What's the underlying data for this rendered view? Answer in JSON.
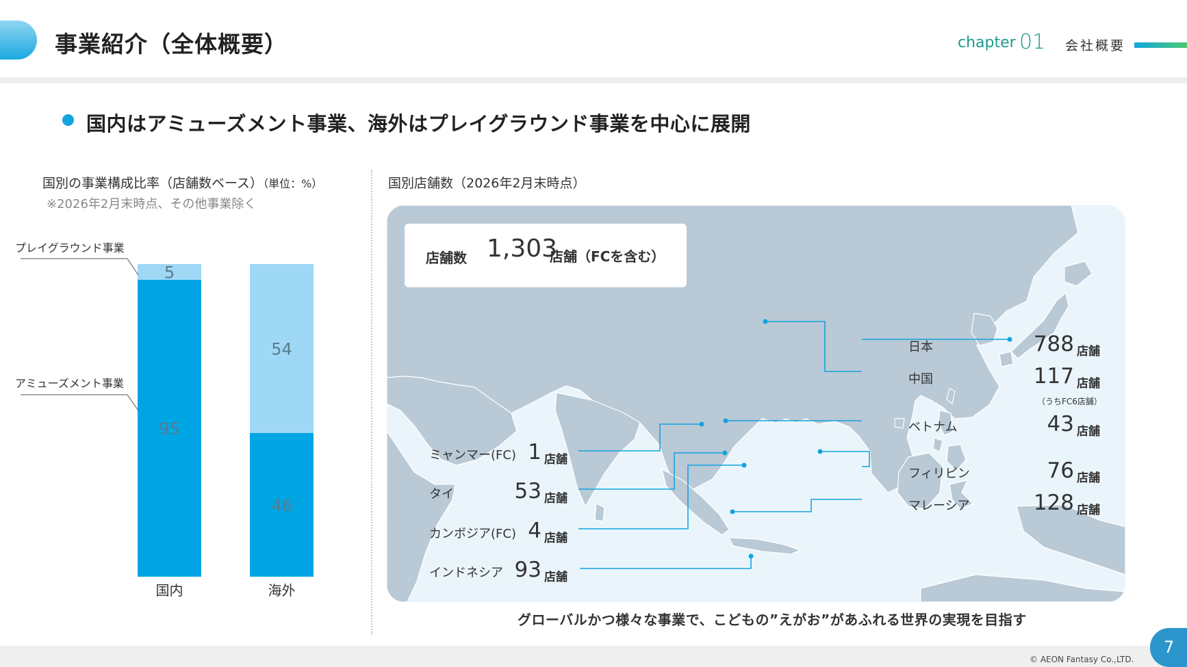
{
  "header": {
    "title": "事業紹介（全体概要）",
    "chapter_label": "chapter",
    "chapter_number": "01",
    "section": "会社概要"
  },
  "headline": "国内はアミューズメント事業、海外はプレイグラウンド事業を中心に展開",
  "left_chart": {
    "title": "国別の事業構成比率（店舗数ベース）",
    "unit": "（単位：%）",
    "note": "※2026年2月末時点、その他事業除く"
  },
  "map": {
    "title": "国別店舗数（2026年2月末時点）",
    "total_label": "店舗数",
    "total_value": "1,303",
    "total_suffix": "店舗（FCを含む）",
    "store_unit": "店舗"
  },
  "caption": "グローバルかつ様々な事業で、こどもの”えがお”があふれる世界の実現を目指す",
  "footer": {
    "copyright": "© AEON Fantasy Co.,LTD.",
    "page": "7"
  },
  "colors": {
    "amusement": "#00a6e4",
    "playground": "#9fd8f5",
    "accent": "#13a3df",
    "map_land": "#b9c9d6",
    "map_sea": "#eaf5fb"
  },
  "chart_data": [
    {
      "type": "bar",
      "stacked": true,
      "categories": [
        "国内",
        "海外"
      ],
      "series": [
        {
          "name": "アミューズメント事業",
          "values": [
            95,
            46
          ]
        },
        {
          "name": "プレイグラウンド事業",
          "values": [
            5,
            54
          ]
        }
      ],
      "ylim": [
        0,
        100
      ],
      "grid": false,
      "legend": "left"
    },
    {
      "type": "table",
      "countries": [
        {
          "name": "日本",
          "stores": 788
        },
        {
          "name": "中国",
          "stores": 117,
          "note": "（うちFC6店舗）"
        },
        {
          "name": "ベトナム",
          "stores": 43
        },
        {
          "name": "フィリピン",
          "stores": 76
        },
        {
          "name": "マレーシア",
          "stores": 128
        },
        {
          "name": "ミャンマー(FC)",
          "stores": 1
        },
        {
          "name": "タイ",
          "stores": 53
        },
        {
          "name": "カンボジア(FC)",
          "stores": 4
        },
        {
          "name": "インドネシア",
          "stores": 93
        }
      ]
    }
  ]
}
